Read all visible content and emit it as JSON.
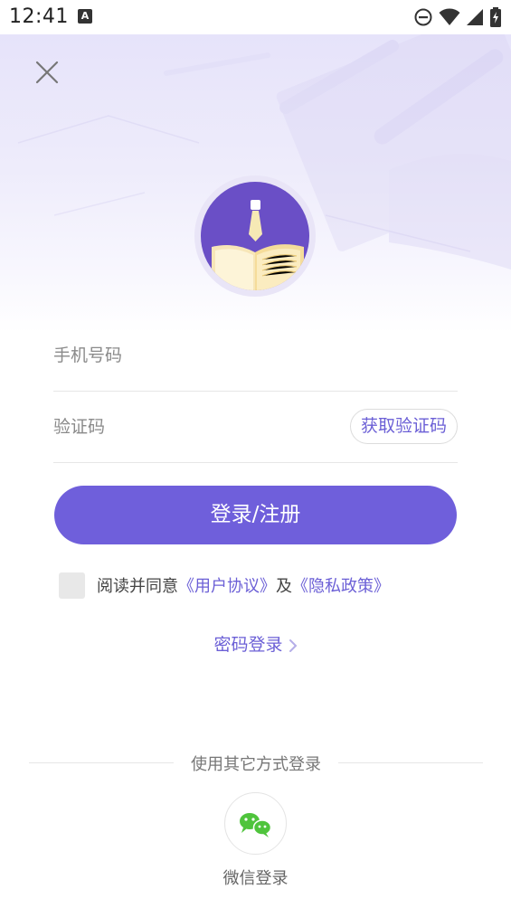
{
  "status_bar": {
    "time": "12:41",
    "notification_badge": "A"
  },
  "header": {
    "close_icon": "close-icon"
  },
  "form": {
    "phone_placeholder": "手机号码",
    "phone_value": "",
    "code_placeholder": "验证码",
    "code_value": "",
    "get_code_label": "获取验证码"
  },
  "login_button_label": "登录/注册",
  "agreement": {
    "prefix": "阅读并同意",
    "user_agreement": "《用户协议》",
    "conjunction": "及",
    "privacy_policy": "《隐私政策》",
    "checked": false
  },
  "password_login_label": "密码登录",
  "other_login": {
    "divider_text": "使用其它方式登录",
    "wechat_label": "微信登录",
    "wechat_icon": "wechat-icon"
  },
  "colors": {
    "accent": "#6f5fdb",
    "link": "#6b5fd6",
    "logo_purple": "#6a4fc6"
  }
}
